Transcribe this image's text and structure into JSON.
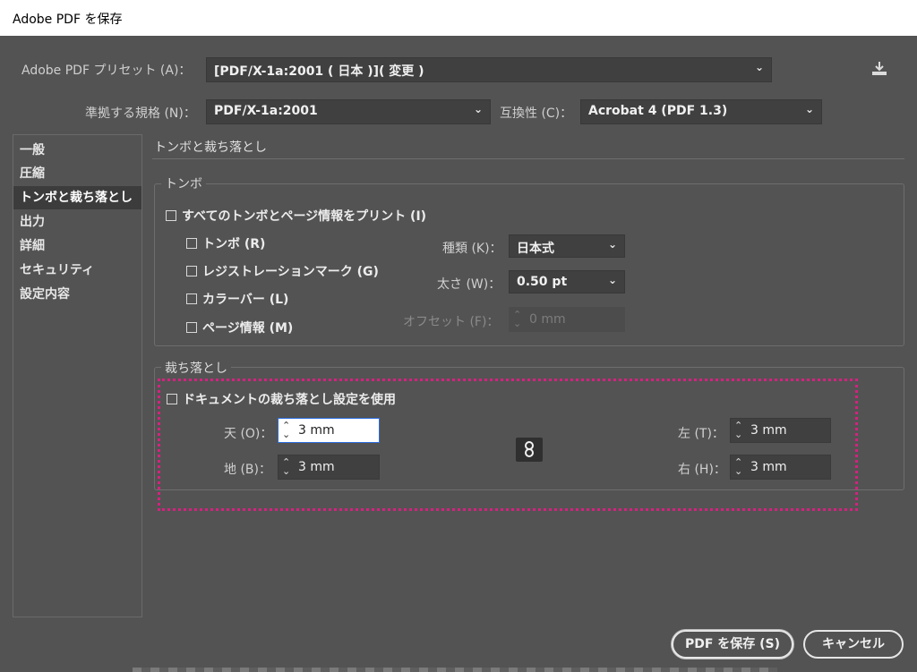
{
  "window": {
    "title": "Adobe PDF を保存"
  },
  "top": {
    "preset_label": "Adobe PDF プリセット (A)：",
    "preset_value": "[PDF/X-1a:2001 ( 日本 )]( 変更 )",
    "standard_label": "準拠する規格 (N)：",
    "standard_value": "PDF/X-1a:2001",
    "compat_label": "互換性 (C)：",
    "compat_value": "Acrobat 4 (PDF 1.3)",
    "save_preset_icon": "download-icon"
  },
  "sidebar": {
    "items": [
      {
        "label": "一般",
        "selected": false
      },
      {
        "label": "圧縮",
        "selected": false
      },
      {
        "label": "トンボと裁ち落とし",
        "selected": true
      },
      {
        "label": "出力",
        "selected": false
      },
      {
        "label": "詳細",
        "selected": false
      },
      {
        "label": "セキュリティ",
        "selected": false
      },
      {
        "label": "設定内容",
        "selected": false
      }
    ]
  },
  "panel": {
    "section_title": "トンボと裁ち落とし",
    "marks": {
      "group_title": "トンボ",
      "all_marks": "すべてのトンボとページ情報をプリント (I)",
      "crop_marks": "トンボ (R)",
      "registration_marks": "レジストレーションマーク (G)",
      "color_bars": "カラーバー (L)",
      "page_info": "ページ情報 (M)",
      "type_label": "種類 (K)：",
      "type_value": "日本式",
      "weight_label": "太さ (W)：",
      "weight_value": "0.50 pt",
      "offset_label": "オフセット (F)：",
      "offset_value": "0 mm"
    },
    "bleed": {
      "group_title": "裁ち落とし",
      "use_document": "ドキュメントの裁ち落とし設定を使用",
      "top_label": "天 (O)：",
      "top_value": "3 mm",
      "bottom_label": "地 (B)：",
      "bottom_value": "3 mm",
      "left_label": "左 (T)：",
      "left_value": "3 mm",
      "right_label": "右 (H)：",
      "right_value": "3 mm",
      "link_icon": "link-icon"
    }
  },
  "buttons": {
    "save": "PDF を保存 (S)",
    "cancel": "キャンセル"
  },
  "colors": {
    "background": "#535353",
    "field": "#404040",
    "highlight": "#d6217f"
  }
}
